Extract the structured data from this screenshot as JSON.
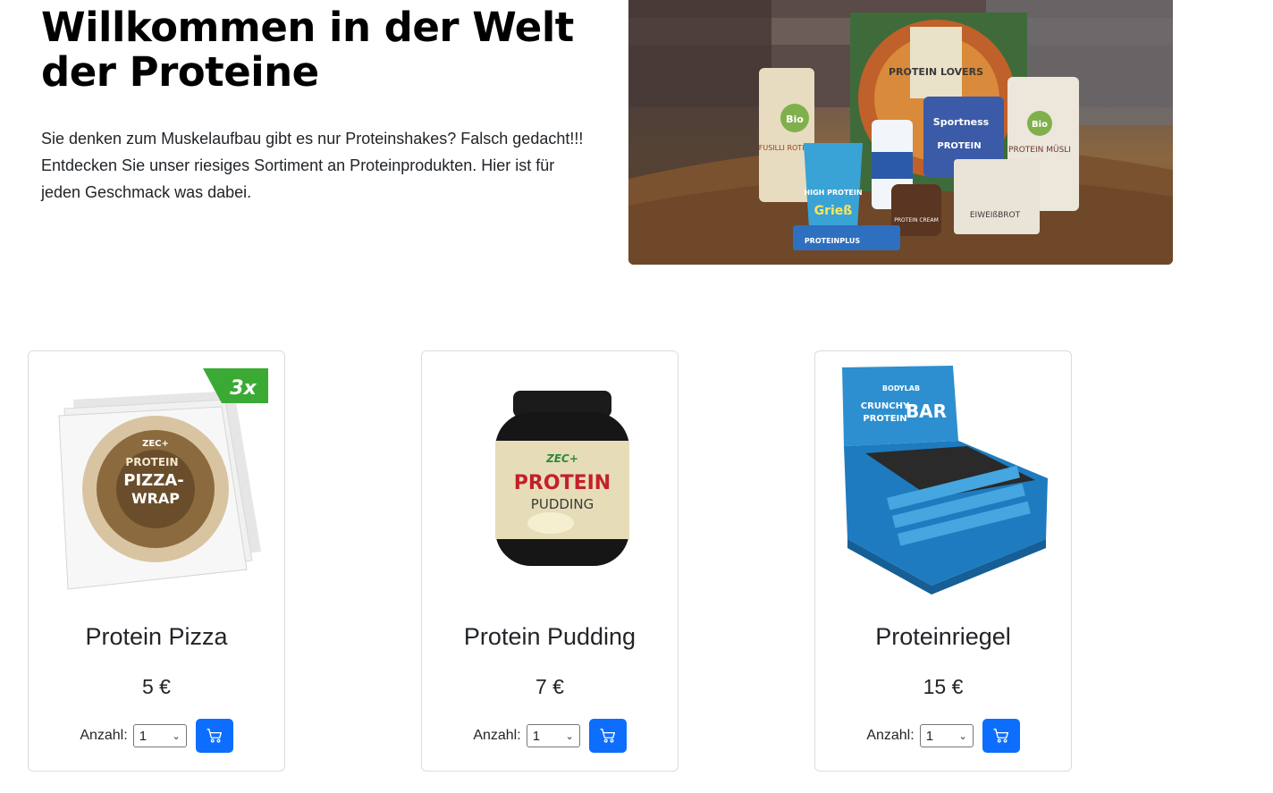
{
  "hero": {
    "title": "Willkommen in der Welt der Proteine",
    "text": "Sie denken zum Muskelaufbau gibt es nur Proteinshakes? Falsch gedacht!!! Entdecken Sie unser riesiges Sortiment an Proteinprodukten. Hier ist für jeden Geschmack was dabei.",
    "image_labels": {
      "pizza": "PROTEIN LOVERS",
      "bio": "Bio",
      "fusilli": "FUSILLI ROTE L",
      "sportness": "Sportness",
      "protein": "PROTEIN",
      "griess": "Grieß",
      "high_protein": "HIGH PROTEIN",
      "protein_cream": "PROTEIN CREAM",
      "eiweissbrot": "EIWEIßBROT",
      "muesli": "PROTEIN MÜSLI",
      "proteinplus": "PROTEINPLUS"
    }
  },
  "products": [
    {
      "name": "Protein Pizza",
      "price": "5 €",
      "qty_label": "Anzahl:",
      "qty_value": "1",
      "badge": "3x",
      "pack_text": [
        "PROTEIN",
        "PIZZA-",
        "WRAP"
      ],
      "brand": "ZEC+",
      "icon": "cart-icon"
    },
    {
      "name": "Protein Pudding",
      "price": "7 €",
      "qty_label": "Anzahl:",
      "qty_value": "1",
      "pack_text": [
        "PROTEIN",
        "PUDDING"
      ],
      "brand": "ZEC+",
      "icon": "cart-icon"
    },
    {
      "name": "Proteinriegel",
      "price": "15 €",
      "qty_label": "Anzahl:",
      "qty_value": "1",
      "pack_text": [
        "CRUNCHY",
        "PROTEIN",
        "BAR"
      ],
      "brand": "BODYLAB",
      "icon": "cart-icon"
    }
  ],
  "colors": {
    "accent": "#0d6efd",
    "badge_green": "#3aaa35"
  }
}
